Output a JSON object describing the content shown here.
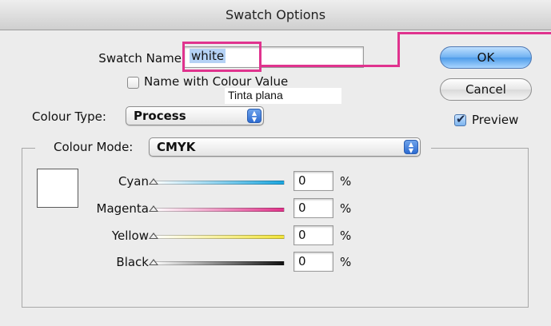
{
  "window": {
    "title": "Swatch Options"
  },
  "swatch_name": {
    "label": "Swatch Name:",
    "value": "white"
  },
  "name_with_colour_value": {
    "label": "Name with Colour Value",
    "checked": false
  },
  "tooltip": {
    "text": "Tinta plana"
  },
  "colour_type": {
    "label": "Colour Type:",
    "value": "Process"
  },
  "colour_mode": {
    "label": "Colour Mode:",
    "value": "CMYK"
  },
  "buttons": {
    "ok": "OK",
    "cancel": "Cancel"
  },
  "preview": {
    "label": "Preview",
    "checked": true
  },
  "sliders": [
    {
      "label": "Cyan",
      "value": "0",
      "unit": "%",
      "color": "#1aa6e0"
    },
    {
      "label": "Magenta",
      "value": "0",
      "unit": "%",
      "color": "#e2338b"
    },
    {
      "label": "Yellow",
      "value": "0",
      "unit": "%",
      "color": "#f2e43a"
    },
    {
      "label": "Black",
      "value": "0",
      "unit": "%",
      "color": "#111111"
    }
  ],
  "colors": {
    "highlight": "#e0338e",
    "swatch_preview": "#ffffff"
  }
}
